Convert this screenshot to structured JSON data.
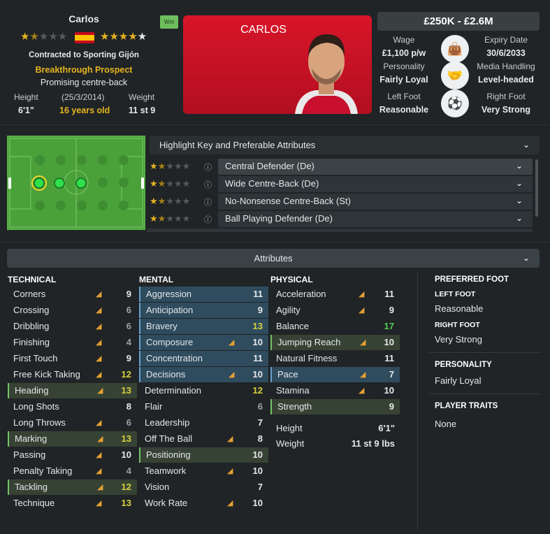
{
  "player": {
    "name": "Carlos",
    "contract": "Contracted to Sporting Gijón",
    "status": "Breakthrough Prospect",
    "description": "Promising centre-back",
    "wnt_badge": "Wnt",
    "height_label": "Height",
    "height": "6'1\"",
    "dob": "(25/3/2014)",
    "age": "16 years old",
    "weight_label": "Weight",
    "weight": "11 st 9",
    "current_ability_stars": 1.5,
    "potential_ability_stars": 4,
    "photo_name": "CARLOS"
  },
  "value": "£250K - £2.6M",
  "contract_info": {
    "wage_label": "Wage",
    "wage": "£1,100 p/w",
    "expiry_label": "Expiry Date",
    "expiry": "30/6/2033",
    "personality_label": "Personality",
    "personality": "Fairly Loyal",
    "media_label": "Media Handling",
    "media": "Level-headed",
    "left_foot_label": "Left Foot",
    "left_foot": "Reasonable",
    "right_foot_label": "Right Foot",
    "right_foot": "Very Strong"
  },
  "roles": {
    "header": "Highlight Key and Preferable Attributes",
    "items": [
      {
        "label": "Central Defender (De)",
        "stars": 1.5,
        "selected": true
      },
      {
        "label": "Wide Centre-Back (De)",
        "stars": 1.5
      },
      {
        "label": "No-Nonsense Centre-Back (St)",
        "stars": 1.5
      },
      {
        "label": "Ball Playing Defender (De)",
        "stars": 1.5
      }
    ]
  },
  "attributes_header": "Attributes",
  "technical": {
    "title": "TECHNICAL",
    "items": [
      {
        "name": "Corners",
        "value": "9",
        "trend": true
      },
      {
        "name": "Crossing",
        "value": "6",
        "trend": true
      },
      {
        "name": "Dribbling",
        "value": "6",
        "trend": true
      },
      {
        "name": "Finishing",
        "value": "4",
        "trend": true
      },
      {
        "name": "First Touch",
        "value": "9",
        "trend": true
      },
      {
        "name": "Free Kick Taking",
        "value": "12",
        "trend": true
      },
      {
        "name": "Heading",
        "value": "13",
        "trend": true,
        "hl": "green"
      },
      {
        "name": "Long Shots",
        "value": "8",
        "trend": false
      },
      {
        "name": "Long Throws",
        "value": "6",
        "trend": true
      },
      {
        "name": "Marking",
        "value": "13",
        "trend": true,
        "hl": "green"
      },
      {
        "name": "Passing",
        "value": "10",
        "trend": true
      },
      {
        "name": "Penalty Taking",
        "value": "4",
        "trend": true
      },
      {
        "name": "Tackling",
        "value": "12",
        "trend": true,
        "hl": "green"
      },
      {
        "name": "Technique",
        "value": "13",
        "trend": true
      }
    ]
  },
  "mental": {
    "title": "MENTAL",
    "items": [
      {
        "name": "Aggression",
        "value": "11",
        "trend": false,
        "hl": "blue"
      },
      {
        "name": "Anticipation",
        "value": "9",
        "trend": false,
        "hl": "blue"
      },
      {
        "name": "Bravery",
        "value": "13",
        "trend": false,
        "hl": "blue"
      },
      {
        "name": "Composure",
        "value": "10",
        "trend": true,
        "hl": "blue"
      },
      {
        "name": "Concentration",
        "value": "11",
        "trend": false,
        "hl": "blue"
      },
      {
        "name": "Decisions",
        "value": "10",
        "trend": true,
        "hl": "blue"
      },
      {
        "name": "Determination",
        "value": "12",
        "trend": false
      },
      {
        "name": "Flair",
        "value": "6",
        "trend": false
      },
      {
        "name": "Leadership",
        "value": "7",
        "trend": false
      },
      {
        "name": "Off The Ball",
        "value": "8",
        "trend": true
      },
      {
        "name": "Positioning",
        "value": "10",
        "trend": false,
        "hl": "green"
      },
      {
        "name": "Teamwork",
        "value": "10",
        "trend": true
      },
      {
        "name": "Vision",
        "value": "7",
        "trend": false
      },
      {
        "name": "Work Rate",
        "value": "10",
        "trend": true
      }
    ]
  },
  "physical": {
    "title": "PHYSICAL",
    "items": [
      {
        "name": "Acceleration",
        "value": "11",
        "trend": true
      },
      {
        "name": "Agility",
        "value": "9",
        "trend": true
      },
      {
        "name": "Balance",
        "value": "17",
        "trend": false
      },
      {
        "name": "Jumping Reach",
        "value": "10",
        "trend": true,
        "hl": "green"
      },
      {
        "name": "Natural Fitness",
        "value": "11",
        "trend": false
      },
      {
        "name": "Pace",
        "value": "7",
        "trend": true,
        "hl": "blue"
      },
      {
        "name": "Stamina",
        "value": "10",
        "trend": true
      },
      {
        "name": "Strength",
        "value": "9",
        "trend": false,
        "hl": "green"
      }
    ],
    "height_label": "Height",
    "height": "6'1\"",
    "weight_label": "Weight",
    "weight": "11 st 9 lbs"
  },
  "side": {
    "pref_foot_title": "PREFERRED FOOT",
    "left_title": "LEFT FOOT",
    "left": "Reasonable",
    "right_title": "RIGHT FOOT",
    "right": "Very Strong",
    "personality_title": "PERSONALITY",
    "personality": "Fairly Loyal",
    "traits_title": "PLAYER TRAITS",
    "traits": "None"
  },
  "colors": {
    "accent_gold": "#e5b320",
    "photo_red": "#d8152a",
    "highlight_green": "#364233",
    "highlight_blue": "#2f4b5e",
    "trend_orange": "#e3a033"
  }
}
